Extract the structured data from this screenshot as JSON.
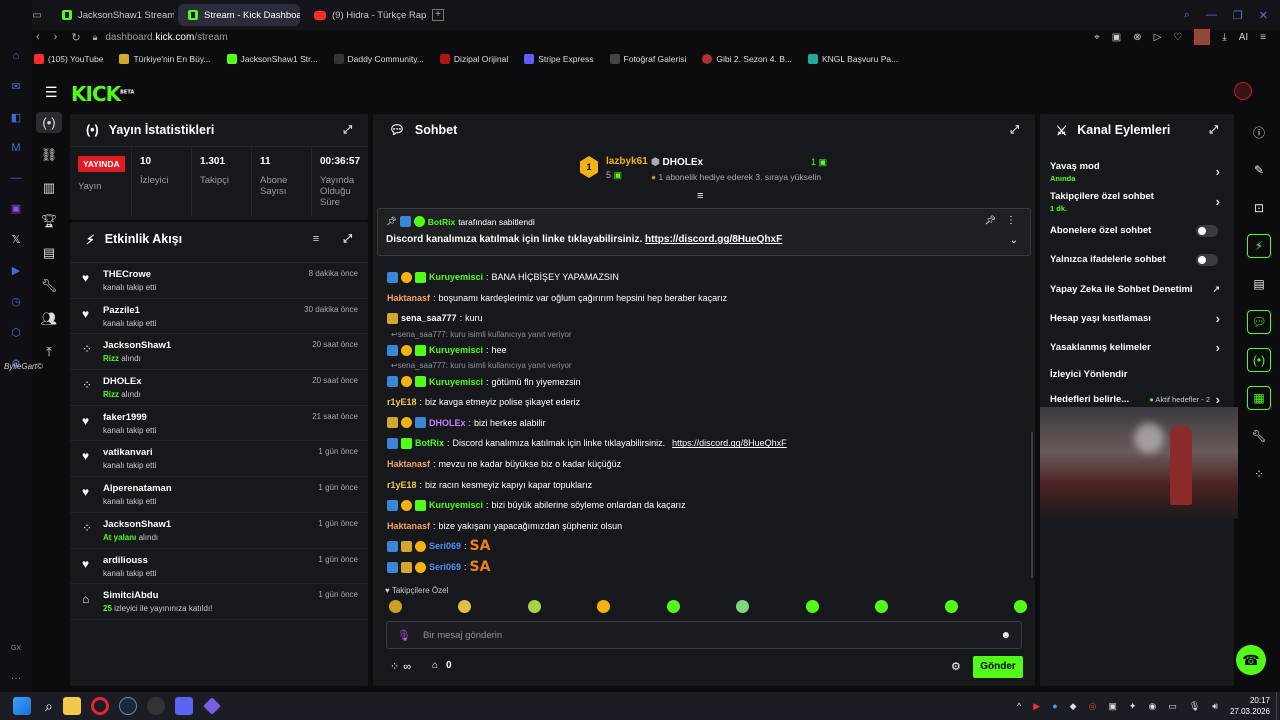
{
  "browser": {
    "tabs": [
      {
        "label": "JacksonShaw1 Stream - W"
      },
      {
        "label": "Stream - Kick Dashboard"
      },
      {
        "label": "(9) Hidra - Türkçe Rap"
      }
    ],
    "url_prefix": "dashboard.",
    "url_host": "kick.com",
    "url_path": "/stream",
    "ai_label": "AI",
    "bookmarks": [
      {
        "label": "(105) YouTube"
      },
      {
        "label": "Türkiye'nin En Büy..."
      },
      {
        "label": "JacksonShaw1 Str..."
      },
      {
        "label": "Daddy Community..."
      },
      {
        "label": "Dizipal Orijinal"
      },
      {
        "label": "Stripe Express"
      },
      {
        "label": "Fotoğraf Galerisi"
      },
      {
        "label": "Gibi 2. Sezon 4. B..."
      },
      {
        "label": "KNGL Başvuru Pa..."
      }
    ]
  },
  "opera_sidebar": {
    "bottom_label": "GX",
    "overlay_text": "BylleGart©"
  },
  "brand": {
    "logo_text": "KICK",
    "beta_label": "BETA"
  },
  "stats_panel": {
    "title": "Yayın İstatistikleri",
    "live_badge": "YAYINDA",
    "items": [
      {
        "value": "",
        "label": "Yayın"
      },
      {
        "value": "10",
        "label": "İzleyici"
      },
      {
        "value": "1.301",
        "label": "Takipçi"
      },
      {
        "value": "11",
        "label": "Abone Sayısı"
      },
      {
        "value": "00:36:57",
        "label": "Yayında Olduğu Süre"
      }
    ]
  },
  "activity": {
    "title": "Etkinlik Akışı",
    "items": [
      {
        "name": "THECrowe",
        "pre": "",
        "highlight": "",
        "post": "kanalı takip etti",
        "time": "8 dakika önce",
        "icon": "heart-icon"
      },
      {
        "name": "Pazzile1",
        "pre": "",
        "highlight": "",
        "post": "kanalı takip etti",
        "time": "30 dakika önce",
        "icon": "heart-icon"
      },
      {
        "name": "JacksonShaw1",
        "pre": "",
        "highlight": "Rizz",
        "post": " alındı",
        "time": "20 saat önce",
        "icon": "points-icon"
      },
      {
        "name": "DHOLEx",
        "pre": "",
        "highlight": "Rizz",
        "post": " alındı",
        "time": "20 saat önce",
        "icon": "points-icon"
      },
      {
        "name": "faker1999",
        "pre": "",
        "highlight": "",
        "post": "kanalı takip etti",
        "time": "21 saat önce",
        "icon": "heart-icon"
      },
      {
        "name": "vatikanvari",
        "pre": "",
        "highlight": "",
        "post": "kanalı takip etti",
        "time": "1 gün önce",
        "icon": "heart-icon"
      },
      {
        "name": "Alperenataman",
        "pre": "",
        "highlight": "",
        "post": "kanalı takip etti",
        "time": "1 gün önce",
        "icon": "heart-icon"
      },
      {
        "name": "JacksonShaw1",
        "pre": "",
        "highlight": "At yalanı",
        "post": " alındı",
        "time": "1 gün önce",
        "icon": "points-icon"
      },
      {
        "name": "ardiliouss",
        "pre": "",
        "highlight": "",
        "post": "kanalı takip etti",
        "time": "1 gün önce",
        "icon": "heart-icon"
      },
      {
        "name": "SimitciAbdu",
        "pre": "",
        "highlight": "25",
        "post": " izleyici ile yayınınıza katıldı!",
        "time": "1 gün önce",
        "icon": "host-icon"
      }
    ]
  },
  "chat": {
    "title": "Sohbet",
    "leader1": {
      "name": "lazbyk61",
      "count": "5"
    },
    "leader2": {
      "name": "DHOLEx",
      "count": "1",
      "sub": "1 abonelik hediye ederek 3. sıraya yükselin"
    },
    "pinned": {
      "by": "BotRix",
      "by_suffix": "tarafından sabitlendi",
      "text": "Discord kanalımıza katılmak için linke tıklayabilirsiniz.",
      "link": "https://discord.gg/8HueQhxF"
    },
    "messages": [
      {
        "user": "Kuruyemisci",
        "color": "#53fc18",
        "text": "BANA HİÇBİŞEY YAPAMAZSIN",
        "badges": [
          "b-blue",
          "b-gold",
          "b-green"
        ]
      },
      {
        "user": "Haktanasf",
        "color": "#f4a261",
        "text": "boşunamı kardeşlerimiz var oğlum çağırırım hepsini hep beraber kaçarız",
        "badges": []
      },
      {
        "user": "sena_saa777",
        "color": "#ffffff",
        "text": "kuru",
        "badges": [
          "b-crown"
        ]
      },
      {
        "reply": "sena_saa777: kuru isimli kullanıcıya yanıt veriyor"
      },
      {
        "user": "Kuruyemisci",
        "color": "#53fc18",
        "text": "hee",
        "badges": [
          "b-blue",
          "b-gold",
          "b-green"
        ]
      },
      {
        "reply": "sena_saa777: kuru isimli kullanıcıya yanıt veriyor"
      },
      {
        "user": "Kuruyemisci",
        "color": "#53fc18",
        "text": "götümü fln yiyemezsin",
        "badges": [
          "b-blue",
          "b-gold",
          "b-green"
        ]
      },
      {
        "user": "r1yE18",
        "color": "#f2c94c",
        "text": "biz kavga etmeyiz polise şikayet ederiz",
        "badges": []
      },
      {
        "user": "DHOLEx",
        "color": "#c77dff",
        "text": "bizi herkes alabilir",
        "badges": [
          "b-crown",
          "b-gold",
          "b-blue"
        ]
      },
      {
        "user": "BotRix",
        "color": "#53fc18",
        "text": "Discord kanalımıza katılmak için linke tıklayabilirsiniz.",
        "link": "https://discord.gg/8HueQhxF",
        "badges": [
          "b-blue",
          "b-green"
        ]
      },
      {
        "user": "Haktanasf",
        "color": "#f4a261",
        "text": "mevzu ne kadar büyükse biz o kadar küçüğüz",
        "badges": []
      },
      {
        "user": "r1yE18",
        "color": "#f2c94c",
        "text": "biz racın kesmeyiz kapıyı kapar topuklarız",
        "badges": []
      },
      {
        "user": "Kuruyemisci",
        "color": "#53fc18",
        "text": "bizi büyük abilerine söyleme onlardan da kaçarız",
        "badges": [
          "b-blue",
          "b-gold",
          "b-green"
        ]
      },
      {
        "user": "Haktanasf",
        "color": "#f4a261",
        "text": "bize yakışanı yapacağımızdan şüpheniz olsun",
        "badges": []
      },
      {
        "user": "Seri069",
        "color": "#4f8ef7",
        "text": "SA",
        "emote": true,
        "badges": [
          "b-blue",
          "b-crown",
          "b-gold"
        ]
      },
      {
        "user": "Seri069",
        "color": "#4f8ef7",
        "text": "SA",
        "emote": true,
        "badges": [
          "b-blue",
          "b-crown",
          "b-gold"
        ]
      }
    ],
    "emote_section_label": "Takipçilere Özel",
    "input_placeholder": "Bir mesaj gönderin",
    "points": "∞",
    "store_count": "0",
    "send_label": "Gönder"
  },
  "channel_actions": {
    "title": "Kanal Eylemleri",
    "slow_mode": {
      "label": "Yavaş mod",
      "sub": "Anında"
    },
    "followers_only": {
      "label": "Takipçilere özel sohbet",
      "sub": "1 dk."
    },
    "items": [
      {
        "label": "Abonelere özel sohbet",
        "kind": "toggle"
      },
      {
        "label": "Yalnızca ifadelerle sohbet",
        "kind": "toggle"
      },
      {
        "label": "Yapay Zeka ile Sohbet Denetimi",
        "kind": "external"
      },
      {
        "label": "Hesap yaşı kısıtlaması",
        "kind": "arrow"
      },
      {
        "label": "Yasaklanmış kelimeler",
        "kind": "arrow"
      },
      {
        "label": "İzleyici Yönlendir",
        "kind": "none"
      }
    ],
    "goals": {
      "label": "Hedefleri belirle...",
      "status": "Aktif hedefler - 2"
    }
  },
  "taskbar": {
    "time": "20:17",
    "date": "27.03.2026"
  },
  "colors": {
    "accent": "#53fc18",
    "panel": "#17181c",
    "live": "#e31b23"
  }
}
